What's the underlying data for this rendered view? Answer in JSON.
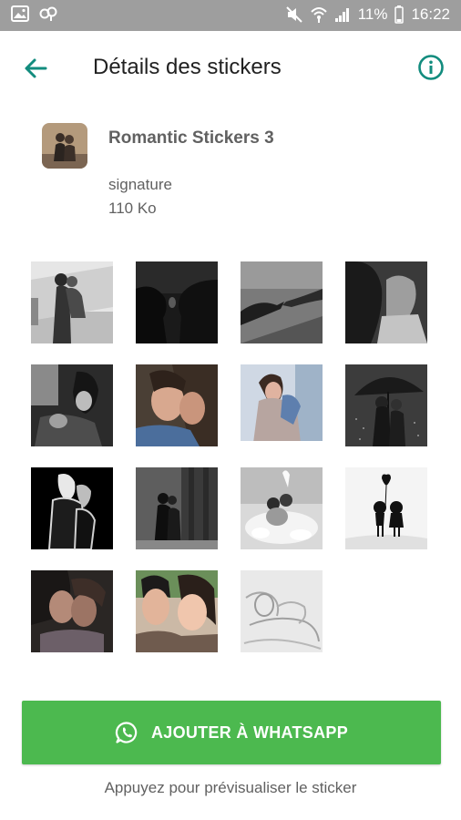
{
  "status_bar": {
    "battery_percent": "11%",
    "time": "16:22",
    "left_icons": [
      "image-icon",
      "link-icon"
    ],
    "right_icons": [
      "mute-icon",
      "wifi-icon",
      "signal-icon",
      "battery-icon"
    ]
  },
  "app_bar": {
    "title": "Détails des stickers",
    "back_icon": "arrow-left-icon",
    "info_icon": "info-icon",
    "accent_color": "#128c7e"
  },
  "pack": {
    "name": "Romantic Stickers 3",
    "author": "signature",
    "size": "110 Ko"
  },
  "stickers": [
    {
      "name": "sticker-1",
      "style": "couple-street"
    },
    {
      "name": "sticker-2",
      "style": "kiss-silhouette"
    },
    {
      "name": "sticker-3",
      "style": "hands-rain"
    },
    {
      "name": "sticker-4",
      "style": "couple-close"
    },
    {
      "name": "sticker-5",
      "style": "couple-bw"
    },
    {
      "name": "sticker-6",
      "style": "couple-color"
    },
    {
      "name": "sticker-7",
      "style": "couple-window"
    },
    {
      "name": "sticker-8",
      "style": "couple-umbrella"
    },
    {
      "name": "sticker-9",
      "style": "couple-glow"
    },
    {
      "name": "sticker-10",
      "style": "couple-rain-street"
    },
    {
      "name": "sticker-11",
      "style": "couple-bath"
    },
    {
      "name": "sticker-12",
      "style": "cartoon-balloon"
    },
    {
      "name": "sticker-13",
      "style": "couple-kiss-dark"
    },
    {
      "name": "sticker-14",
      "style": "couple-selfie"
    },
    {
      "name": "sticker-15",
      "style": "couple-sketch"
    }
  ],
  "add_button": {
    "label": "AJOUTER À WHATSAPP",
    "icon": "whatsapp-icon",
    "color": "#4cb94f"
  },
  "hint": "Appuyez pour prévisualiser le sticker"
}
